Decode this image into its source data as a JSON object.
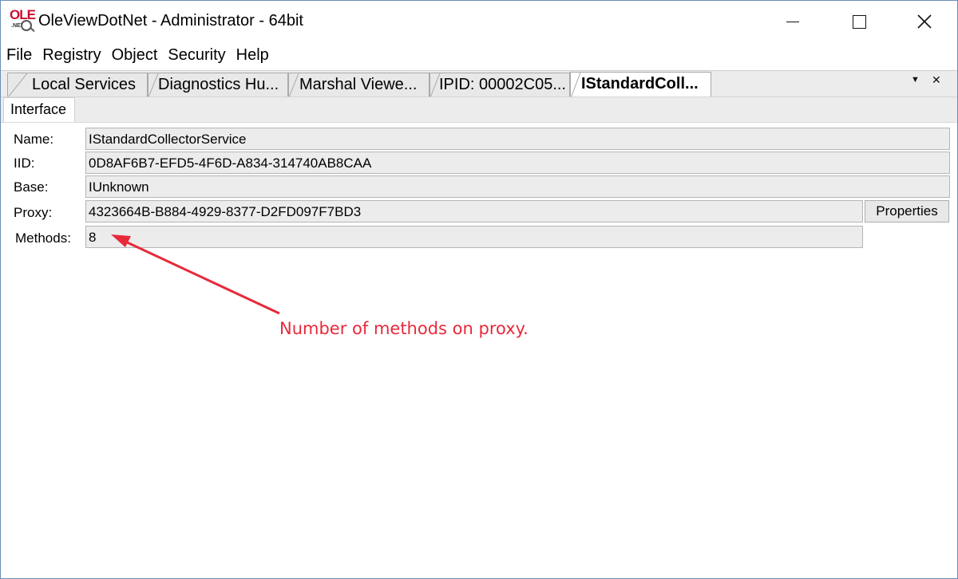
{
  "window": {
    "title": "OleViewDotNet - Administrator - 64bit",
    "icon_text": "OLE",
    "icon_subtext": ".NET"
  },
  "menu": [
    "File",
    "Registry",
    "Object",
    "Security",
    "Help"
  ],
  "tabs": [
    {
      "label": "Local Services",
      "active": false
    },
    {
      "label": "Diagnostics Hu...",
      "active": false
    },
    {
      "label": "Marshal Viewe...",
      "active": false
    },
    {
      "label": "IPID: 00002C05...",
      "active": false
    },
    {
      "label": "IStandardColl...",
      "active": true
    }
  ],
  "inner_tab": "Interface",
  "fields": {
    "name": {
      "label": "Name:",
      "value": "IStandardCollectorService"
    },
    "iid": {
      "label": "IID:",
      "value": "0D8AF6B7-EFD5-4F6D-A834-314740AB8CAA"
    },
    "base": {
      "label": "Base:",
      "value": "IUnknown"
    },
    "proxy": {
      "label": "Proxy:",
      "value": "4323664B-B884-4929-8377-D2FD097F7BD3"
    },
    "methods": {
      "label": "Methods:",
      "value": "8"
    }
  },
  "properties_button": "Properties",
  "annotation": {
    "text": "Number of methods on proxy.",
    "color": "#e8293a"
  },
  "icons": {
    "dropdown": "chevron-down-icon",
    "close": "close-icon"
  }
}
